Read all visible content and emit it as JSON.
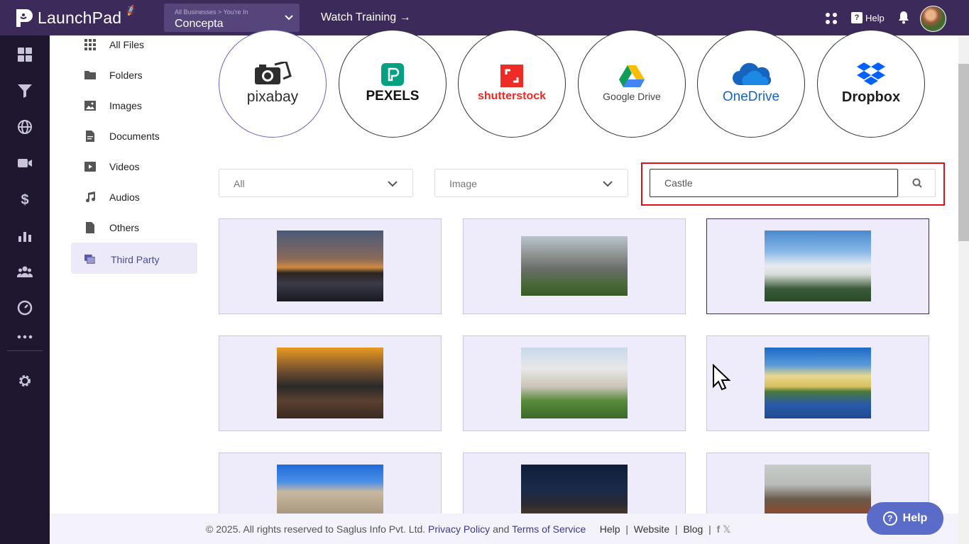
{
  "topbar": {
    "brand": "LaunchPad",
    "business_small": "All Businesses > You're In",
    "business_name": "Concepta",
    "watch_training": "Watch Training →",
    "help": "Help"
  },
  "rail": {
    "icons": [
      "dashboard-icon",
      "funnel-icon",
      "globe-icon",
      "video-icon",
      "dollar-icon",
      "chart-icon",
      "users-icon",
      "gauge-icon",
      "more-icon",
      "settings-icon"
    ]
  },
  "subnav": {
    "items": [
      {
        "label": "All Files",
        "icon": "grid-icon"
      },
      {
        "label": "Folders",
        "icon": "folder-icon"
      },
      {
        "label": "Images",
        "icon": "image-icon"
      },
      {
        "label": "Documents",
        "icon": "document-icon"
      },
      {
        "label": "Videos",
        "icon": "video-file-icon"
      },
      {
        "label": "Audios",
        "icon": "music-icon"
      },
      {
        "label": "Others",
        "icon": "file-icon"
      },
      {
        "label": "Third Party",
        "icon": "third-party-icon",
        "active": true
      }
    ]
  },
  "providers": [
    {
      "label": "pixabay",
      "selected": true
    },
    {
      "label": "PEXELS"
    },
    {
      "label": "shutterstock"
    },
    {
      "label": "Google Drive"
    },
    {
      "label": "OneDrive"
    },
    {
      "label": "Dropbox"
    }
  ],
  "filters": {
    "scope": "All",
    "type": "Image",
    "search_value": "Castle"
  },
  "footer": {
    "copyright": "©  2025. All rights reserved to Saglus Info Pvt. Ltd.",
    "privacy": "Privacy Policy",
    "and": "and",
    "terms": "Terms of Service",
    "help": "Help",
    "website": "Website",
    "blog": "Blog",
    "sep": "|"
  },
  "help_button": "Help",
  "colors": {
    "topbar": "#3c2a5a",
    "rail": "#1f1730",
    "highlight": "#e0101a",
    "card_bg": "#eeecfa",
    "help_float": "#5b6cc8"
  }
}
